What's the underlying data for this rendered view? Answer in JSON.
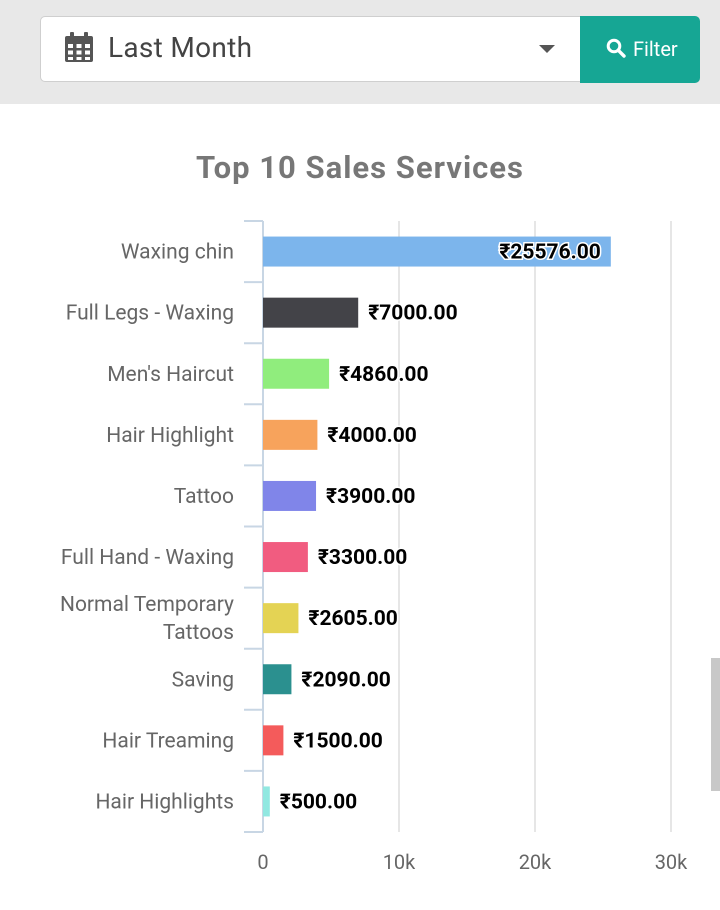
{
  "filter": {
    "period_value": "Last Month",
    "button_label": "Filter"
  },
  "chart_data": {
    "type": "bar",
    "orientation": "horizontal",
    "title": "Top 10 Sales Services",
    "categories": [
      "Waxing chin",
      "Full Legs - Waxing",
      "Men's Haircut",
      "Hair Highlight",
      "Tattoo",
      "Full Hand - Waxing",
      "Normal Temporary Tattoos",
      "Saving",
      "Hair Treaming",
      "Hair Highlights"
    ],
    "category_lines": [
      [
        "Waxing chin"
      ],
      [
        "Full Legs - Waxing"
      ],
      [
        "Men's Haircut"
      ],
      [
        "Hair Highlight"
      ],
      [
        "Tattoo"
      ],
      [
        "Full Hand - Waxing"
      ],
      [
        "Normal Temporary",
        "Tattoos"
      ],
      [
        "Saving"
      ],
      [
        "Hair Treaming"
      ],
      [
        "Hair Highlights"
      ]
    ],
    "values": [
      25576.0,
      7000.0,
      4860.0,
      4000.0,
      3900.0,
      3300.0,
      2605.0,
      2090.0,
      1500.0,
      500.0
    ],
    "data_labels": [
      "₹25576.00",
      "₹7000.00",
      "₹4860.00",
      "₹4000.00",
      "₹3900.00",
      "₹3300.00",
      "₹2605.00",
      "₹2090.00",
      "₹1500.00",
      "₹500.00"
    ],
    "colors": [
      "#7cb5ec",
      "#434348",
      "#90ed7d",
      "#f7a35c",
      "#8085e9",
      "#f15c80",
      "#e4d354",
      "#2b908f",
      "#f45b5b",
      "#91e8e1"
    ],
    "xlim": [
      0,
      30000
    ],
    "x_ticks": [
      0,
      10000,
      20000,
      30000
    ],
    "x_tick_labels": [
      "0",
      "10k",
      "20k",
      "30k"
    ],
    "grid": true,
    "legend": false
  }
}
